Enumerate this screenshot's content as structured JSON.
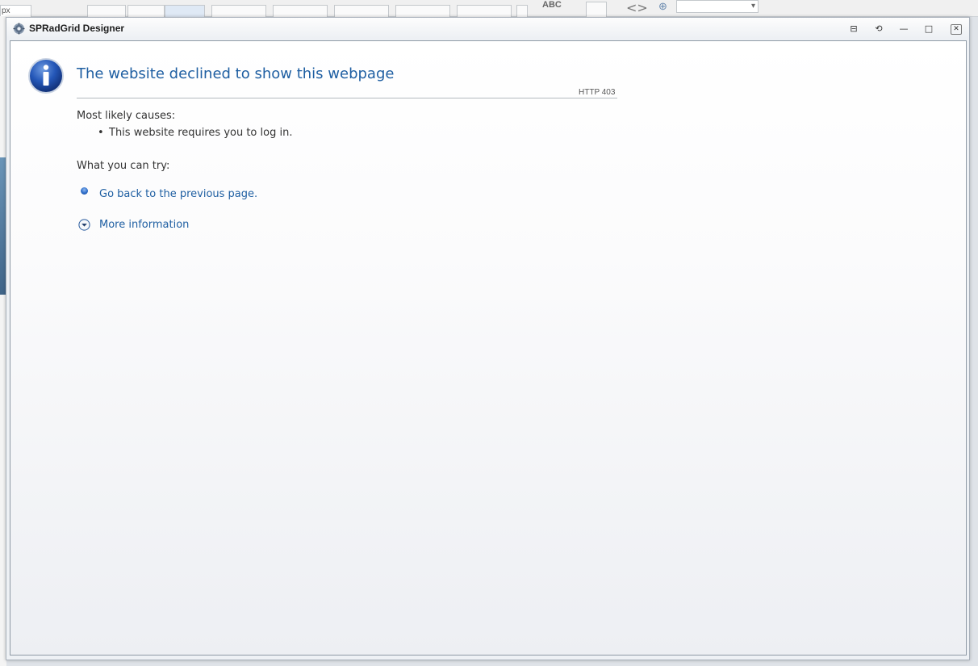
{
  "background_app": {
    "zoom_value": "px",
    "spell_label": "ABC"
  },
  "window": {
    "title": "SPRadGrid Designer",
    "controls": {
      "pin": "⊟",
      "refresh": "⟲",
      "minimize": "—",
      "maximize": "□",
      "close": "✕"
    }
  },
  "error_page": {
    "heading": "The website declined to show this webpage",
    "http_code": "HTTP 403",
    "causes_label": "Most likely causes:",
    "causes": [
      "This website requires you to log in."
    ],
    "try_label": "What you can try:",
    "go_back_link": "Go back to the previous page.",
    "more_info_link": "More information"
  },
  "colors": {
    "link": "#1f5fa2",
    "info_icon": "#1c4fa0"
  },
  "icons": {
    "app": "gear-icon",
    "info": "info-icon",
    "bullet": "blue-dot-icon",
    "expand": "chevron-down-circle-icon"
  }
}
